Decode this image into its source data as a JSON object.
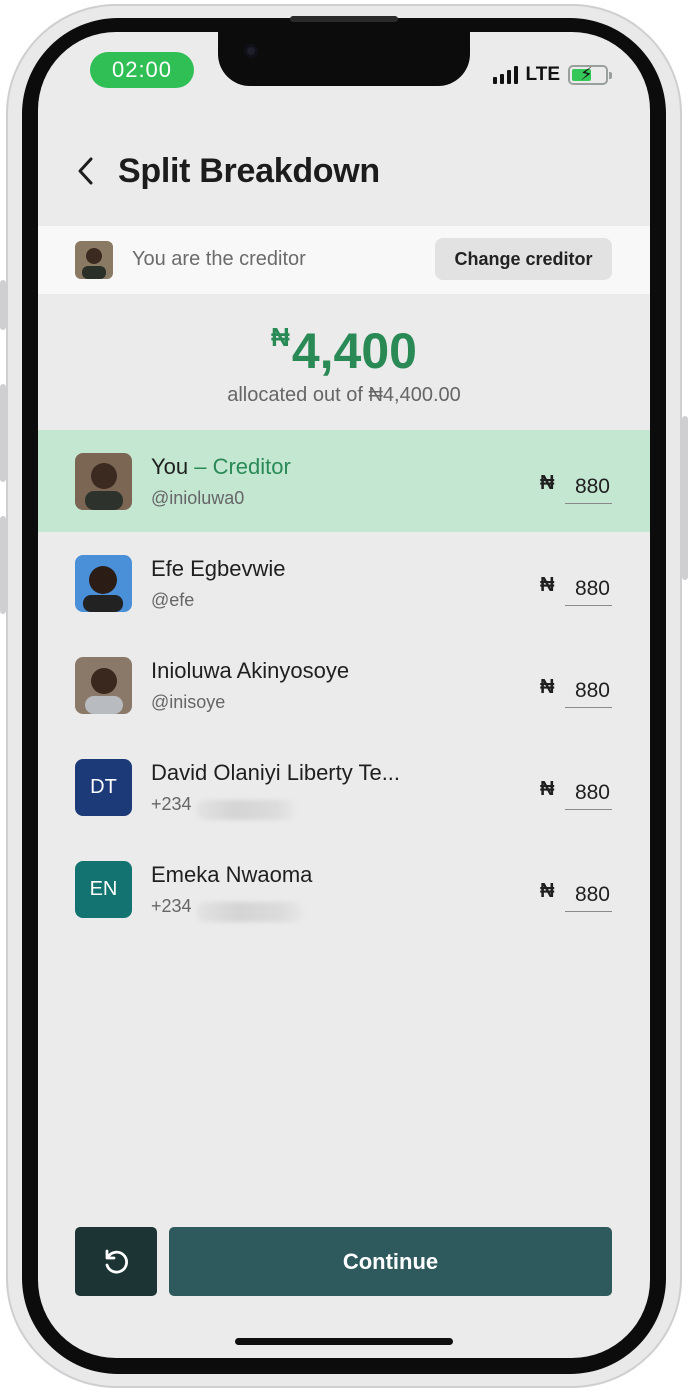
{
  "status_bar": {
    "time": "02:00",
    "network": "LTE"
  },
  "header": {
    "title": "Split Breakdown",
    "back_icon": "chevron-left-icon"
  },
  "creditor_bar": {
    "text": "You are the creditor",
    "change_button": "Change creditor"
  },
  "summary": {
    "currency_symbol": "₦",
    "allocated_amount": "4,400",
    "allocated_text": "allocated out of ₦4,400.00"
  },
  "participants": [
    {
      "name": "You",
      "creditor_label": " – Creditor",
      "handle": "@inioluwa0",
      "currency": "₦",
      "amount": "880",
      "avatar_type": "photo",
      "avatar_color": "#6b5a4a",
      "highlighted": true
    },
    {
      "name": "Efe Egbevwie",
      "handle": "@efe",
      "currency": "₦",
      "amount": "880",
      "avatar_type": "photo",
      "avatar_color": "#4a90d9"
    },
    {
      "name": "Inioluwa Akinyosoye",
      "handle": "@inisoye",
      "currency": "₦",
      "amount": "880",
      "avatar_type": "photo",
      "avatar_color": "#7d6a5a"
    },
    {
      "name": "David Olaniyi Liberty Te...",
      "handle": "+234",
      "currency": "₦",
      "amount": "880",
      "avatar_type": "initials",
      "initials": "DT",
      "avatar_color": "#1c3a78"
    },
    {
      "name": "Emeka Nwaoma",
      "handle": "+234",
      "currency": "₦",
      "amount": "880",
      "avatar_type": "initials",
      "initials": "EN",
      "avatar_color": "#137371"
    }
  ],
  "footer": {
    "reset_icon": "reset-icon",
    "continue_label": "Continue"
  },
  "colors": {
    "accent_green": "#2a8a56",
    "highlight_row": "#c4e7d2",
    "primary_button": "#2f5a5d",
    "reset_button": "#1c3434"
  }
}
